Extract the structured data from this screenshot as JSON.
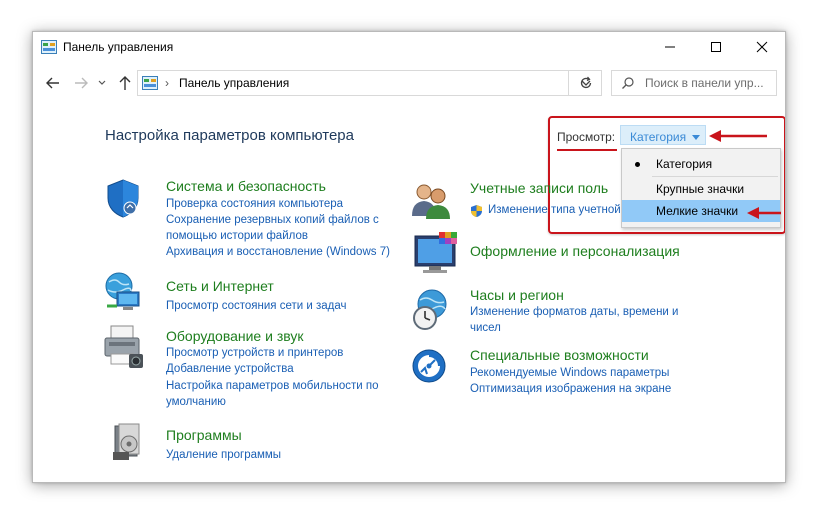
{
  "window": {
    "title": "Панель управления"
  },
  "address": {
    "path": "Панель управления"
  },
  "search": {
    "placeholder": "Поиск в панели упр..."
  },
  "page_title": "Настройка параметров компьютера",
  "view_by": {
    "label": "Просмотр:",
    "value": "Категория",
    "options": [
      "Категория",
      "Крупные значки",
      "Мелкие значки"
    ],
    "highlighted": "Мелкие значки"
  },
  "categories": {
    "security": {
      "title": "Система и безопасность",
      "links": [
        "Проверка состояния компьютера",
        "Сохранение резервных копий файлов с",
        "помощью истории файлов",
        "Архивация и восстановление (Windows 7)"
      ]
    },
    "network": {
      "title": "Сеть и Интернет",
      "links": [
        "Просмотр состояния сети и задач"
      ]
    },
    "hardware": {
      "title": "Оборудование и звук",
      "links": [
        "Просмотр устройств и принтеров",
        "Добавление устройства",
        "Настройка параметров мобильности по",
        "умолчанию"
      ]
    },
    "programs": {
      "title": "Программы",
      "links": [
        "Удаление программы"
      ]
    },
    "accounts": {
      "title": "Учетные записи поль",
      "links": [
        "Изменение типа учетной"
      ]
    },
    "appearance": {
      "title": "Оформление и персонализация"
    },
    "clock": {
      "title": "Часы и регион",
      "links": [
        "Изменение форматов даты, времени и",
        "чисел"
      ]
    },
    "access": {
      "title": "Специальные возможности",
      "links": [
        "Рекомендуемые Windows параметры",
        "Оптимизация изображения на экране"
      ]
    }
  },
  "colors": {
    "annotation": "#c9141b",
    "link": "#1a5fb4",
    "category_title": "#1e7e1e",
    "heading": "#1e395b"
  }
}
